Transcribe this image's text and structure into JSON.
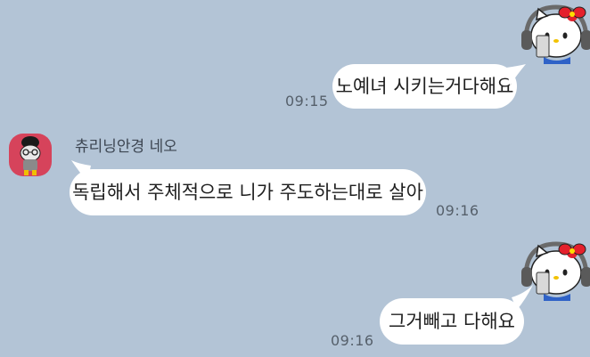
{
  "conversation": {
    "messages": [
      {
        "sender": "me",
        "text": "노예녀 시키는거다해요",
        "time": "09:15"
      },
      {
        "sender": "friend",
        "name": "츄리닝안경 네오",
        "text": "독립해서 주체적으로 니가 주도하는대로 살아",
        "time": "09:16"
      },
      {
        "sender": "me",
        "text": "그거빼고 다해요",
        "time": "09:16"
      }
    ]
  },
  "colors": {
    "background": "#b3c4d6",
    "bubble": "#ffffff",
    "friend_avatar": "#d6435b"
  },
  "icons": {
    "my_avatar": "hello-kitty-headphones-icon",
    "friend_avatar": "neo-cat-glasses-icon"
  }
}
